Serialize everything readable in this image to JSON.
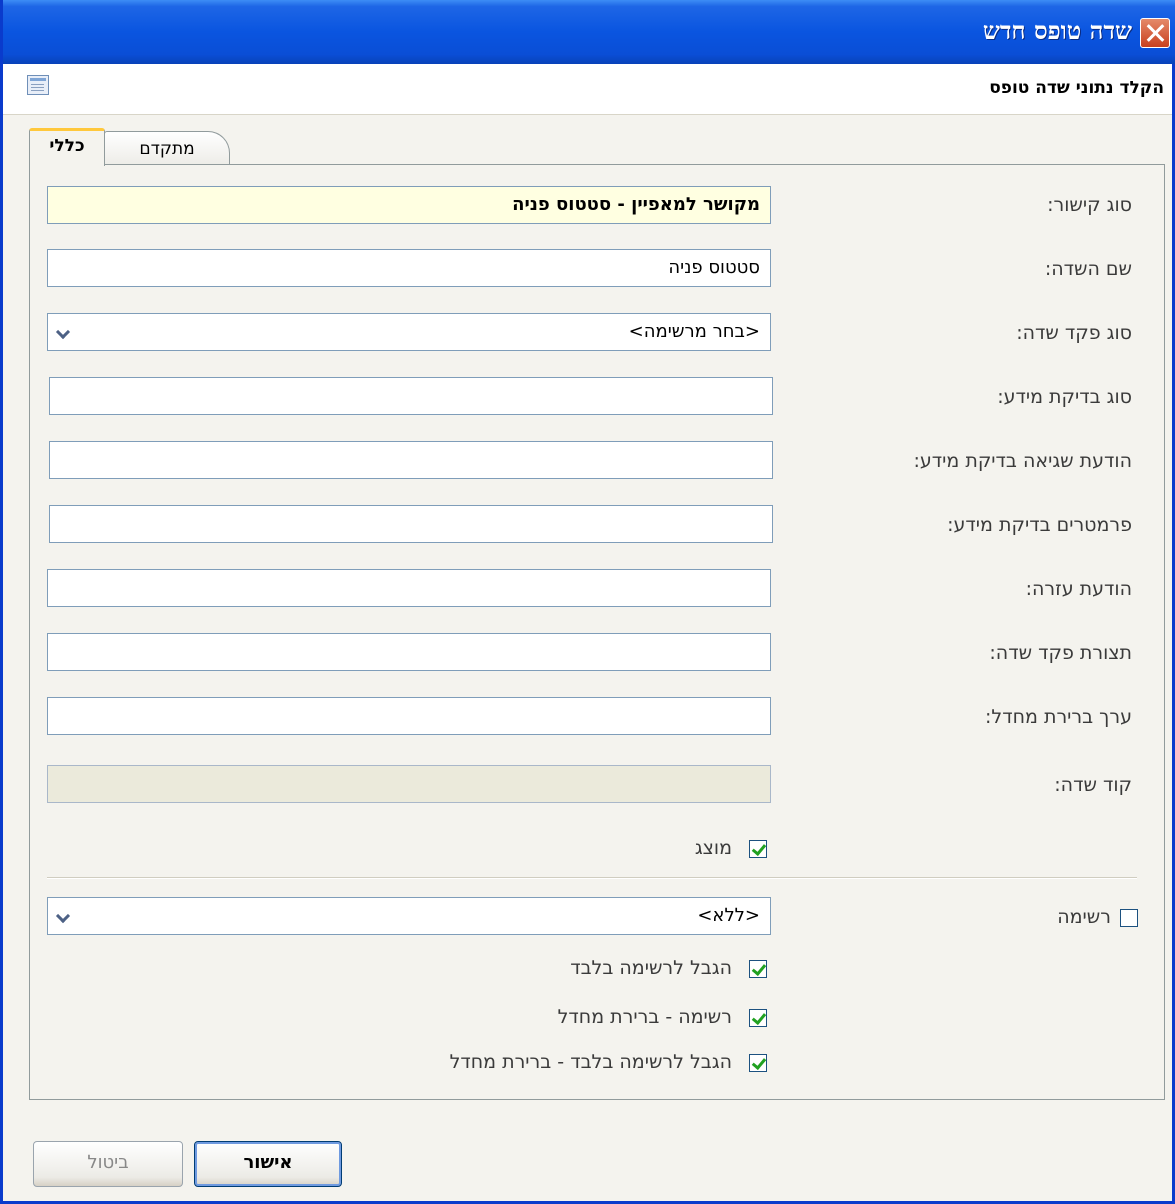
{
  "window": {
    "title": "שדה טופס חדש"
  },
  "header": {
    "subtitle": "הקלד נתוני שדה טופס"
  },
  "tabs": {
    "general": "כללי",
    "advanced": "מתקדם"
  },
  "fields": {
    "link_type": {
      "label": "סוג קישור:",
      "value": "מקושר למאפיין - סטטוס פניה"
    },
    "field_name": {
      "label": "שם השדה:",
      "value": "סטטוס פניה"
    },
    "control_type": {
      "label": "סוג פקד שדה:",
      "value": "<בחר מרשימה>"
    },
    "validation_type": {
      "label": "סוג בדיקת מידע:",
      "value": ""
    },
    "validation_error": {
      "label": "הודעת שגיאה בדיקת מידע:",
      "value": ""
    },
    "validation_params": {
      "label": "פרמטרים בדיקת מידע:",
      "value": ""
    },
    "help_message": {
      "label": "הודעת עזרה:",
      "value": ""
    },
    "control_config": {
      "label": "תצורת פקד שדה:",
      "value": ""
    },
    "default_value": {
      "label": "ערך ברירת מחדל:",
      "value": ""
    },
    "field_code": {
      "label": "קוד שדה:",
      "value": ""
    }
  },
  "checkboxes": {
    "displayed": {
      "label": "מוצג",
      "checked": true
    },
    "list": {
      "label": "רשימה",
      "checked": false
    },
    "restrict_list": {
      "label": "הגבל לרשימה בלבד",
      "checked": true
    },
    "list_default": {
      "label": "רשימה - ברירת מחדל",
      "checked": true
    },
    "restrict_list_default": {
      "label": "הגבל לרשימה בלבד - ברירת מחדל",
      "checked": true
    }
  },
  "list_select": {
    "value": "<ללא>"
  },
  "buttons": {
    "ok": "אישור",
    "cancel": "ביטול"
  }
}
